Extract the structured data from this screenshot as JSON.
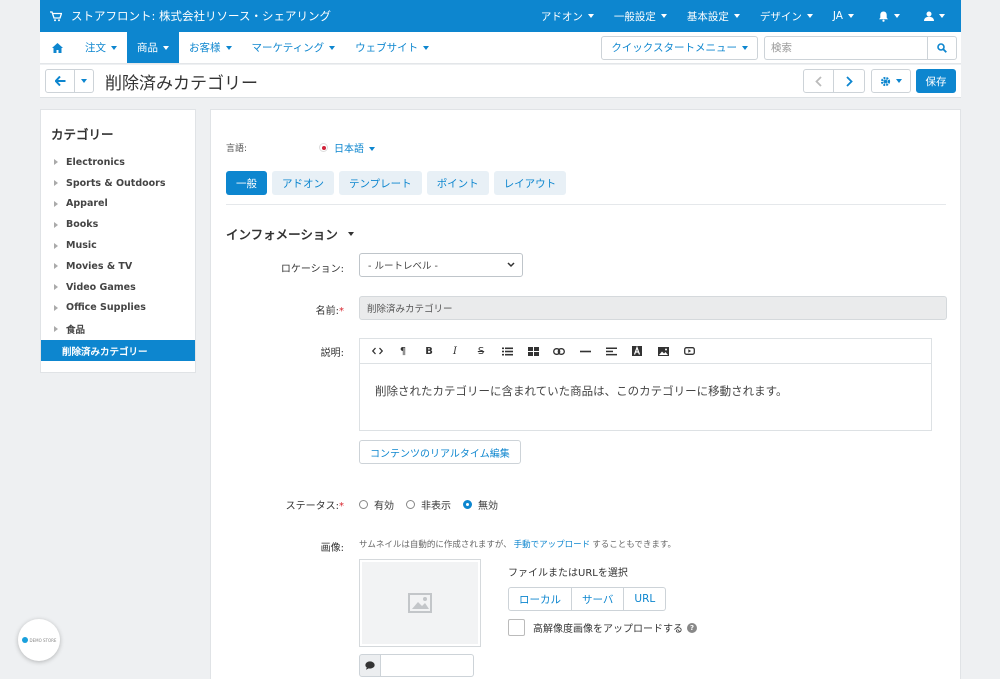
{
  "topbar": {
    "store_label": "ストアフロント: 株式会社リソース・シェアリング",
    "menus": [
      "アドオン",
      "一般設定",
      "基本設定",
      "デザイン",
      "JA"
    ]
  },
  "mainnav": {
    "items": [
      "注文",
      "商品",
      "お客様",
      "マーケティング",
      "ウェブサイト"
    ],
    "active_index": 1,
    "quickstart_label": "クイックスタートメニュー",
    "search_placeholder": "検索"
  },
  "titlebar": {
    "title": "削除済みカテゴリー",
    "save_label": "保存"
  },
  "sidebar": {
    "heading": "カテゴリー",
    "items": [
      "Electronics",
      "Sports & Outdoors",
      "Apparel",
      "Books",
      "Music",
      "Movies & TV",
      "Video Games",
      "Office Supplies",
      "食品"
    ],
    "selected_label": "削除済みカテゴリー"
  },
  "form": {
    "language_label": "言語:",
    "language_value": "日本語",
    "tabs": [
      "一般",
      "アドオン",
      "テンプレート",
      "ポイント",
      "レイアウト"
    ],
    "section_title": "インフォメーション",
    "location_label": "ロケーション:",
    "location_value": "- ルートレベル -",
    "name_label": "名前:",
    "name_value": "削除済みカテゴリー",
    "description_label": "説明:",
    "description_text": "削除されたカテゴリーに含まれていた商品は、このカテゴリーに移動されます。",
    "live_edit_label": "コンテンツのリアルタイム編集",
    "status_label": "ステータス:",
    "status_options": [
      "有効",
      "非表示",
      "無効"
    ],
    "status_selected": "無効",
    "image_label": "画像:",
    "image_hint_before": "サムネイルは自動的に作成されますが、",
    "image_hint_link": "手動でアップロード",
    "image_hint_after": "することもできます。",
    "file_select_label": "ファイルまたはURLを選択",
    "file_buttons": [
      "ローカル",
      "サーバ",
      "URL"
    ],
    "hires_label": "高解像度画像をアップロードする",
    "required_mark": "*"
  },
  "widget": {
    "logo_text": "DEMO STORE"
  },
  "colors": {
    "brand": "#0d86cf",
    "required": "#d8252e"
  },
  "icons": [
    "cart-icon",
    "bell-icon",
    "user-icon",
    "home-icon",
    "search-icon",
    "arrow-left-icon",
    "chevron-left-icon",
    "chevron-right-icon",
    "gear-icon",
    "image-placeholder-icon",
    "comment-icon",
    "question-icon"
  ]
}
